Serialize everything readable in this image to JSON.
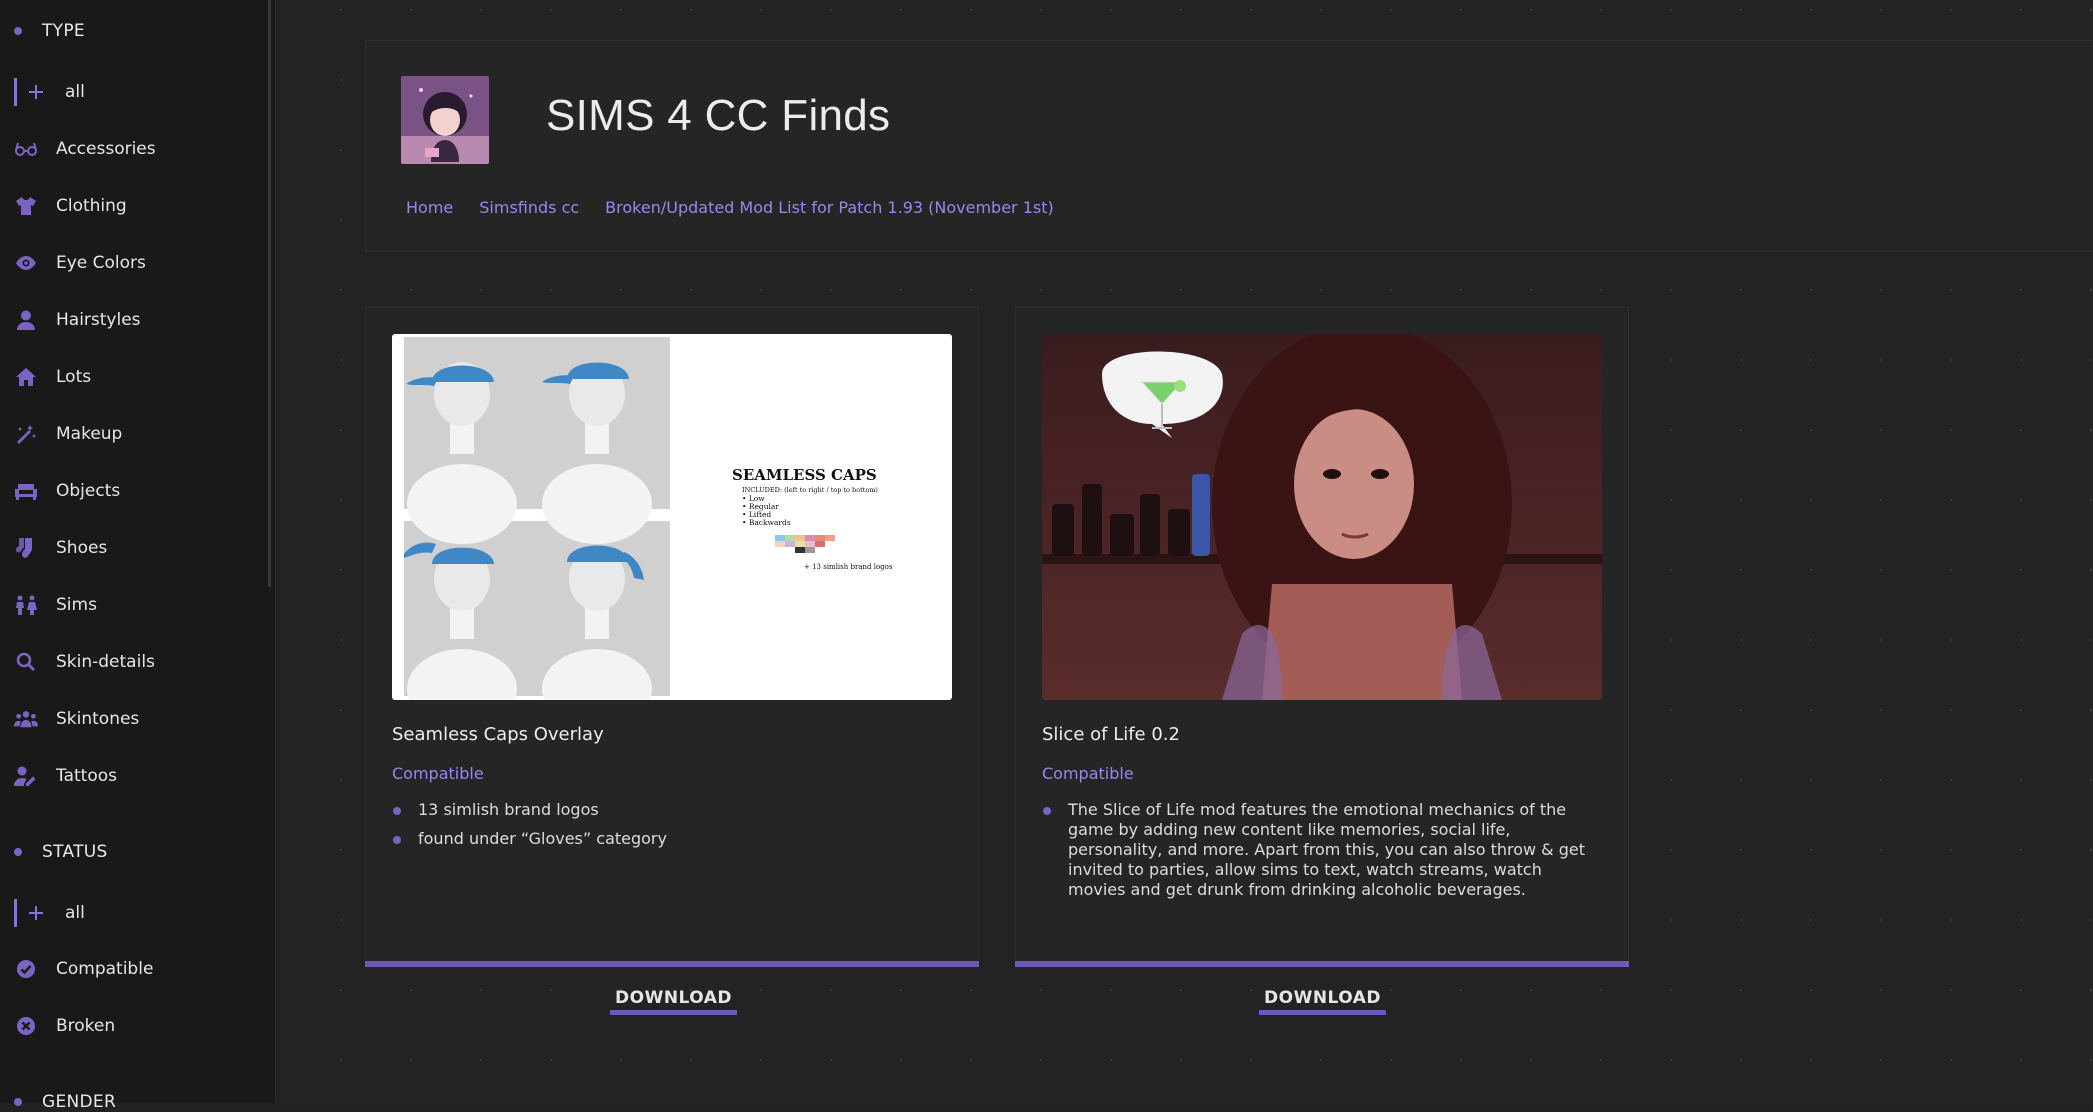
{
  "sidebar": {
    "type_heading": "TYPE",
    "type_items": [
      {
        "label": "all",
        "icon": "plus-icon"
      },
      {
        "label": "Accessories",
        "icon": "glasses-icon"
      },
      {
        "label": "Clothing",
        "icon": "shirt-icon"
      },
      {
        "label": "Eye Colors",
        "icon": "eye-icon"
      },
      {
        "label": "Hairstyles",
        "icon": "user-icon"
      },
      {
        "label": "Lots",
        "icon": "home-icon"
      },
      {
        "label": "Makeup",
        "icon": "magic-wand-icon"
      },
      {
        "label": "Objects",
        "icon": "sofa-icon"
      },
      {
        "label": "Shoes",
        "icon": "socks-icon"
      },
      {
        "label": "Sims",
        "icon": "people-icon"
      },
      {
        "label": "Skin-details",
        "icon": "search-icon"
      },
      {
        "label": "Skintones",
        "icon": "group-icon"
      },
      {
        "label": "Tattoos",
        "icon": "user-pen-icon"
      }
    ],
    "status_heading": "STATUS",
    "status_items": [
      {
        "label": "all",
        "icon": "plus-icon"
      },
      {
        "label": "Compatible",
        "icon": "check-circle-icon"
      },
      {
        "label": "Broken",
        "icon": "x-circle-icon"
      }
    ],
    "gender_heading": "GENDER"
  },
  "header": {
    "title": "SIMS 4 CC Finds",
    "nav": [
      "Home",
      "Simsfinds cc",
      "Broken/Updated Mod List for Patch 1.93 (November 1st)"
    ]
  },
  "cards": [
    {
      "title": "Seamless Caps Overlay",
      "status": "Compatible",
      "bullets": [
        "13 simlish brand logos",
        "found under “Gloves” category"
      ],
      "download": "DOWNLOAD",
      "image_text": {
        "heading": "SEAMLESS CAPS",
        "included": "INCLUDED: (left to right / top to bottom)",
        "list": [
          "Low",
          "Regular",
          "Lifted",
          "Backwards"
        ],
        "note": "+ 13 simlish brand logos"
      }
    },
    {
      "title": "Slice of Life 0.2",
      "status": "Compatible",
      "bullets": [
        "The Slice of Life mod features the emotional mechanics of the game by adding new content like memories, social life, personality, and more. Apart from this, you can also throw & get invited to parties, allow sims to text, watch streams, watch movies and get drunk from drinking alcoholic beverages."
      ],
      "download": "DOWNLOAD"
    }
  ],
  "colors": {
    "accent": "#8a70e0",
    "bar": "#6d57b8",
    "link": "#9a86ee",
    "background": "#232323",
    "sidebar": "#191919"
  }
}
